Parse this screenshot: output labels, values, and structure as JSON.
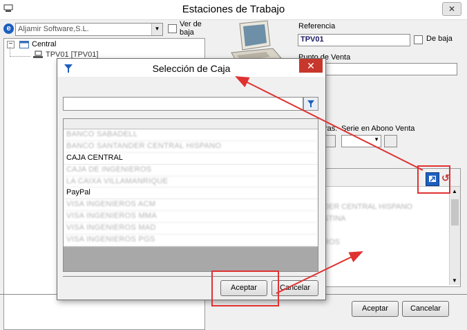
{
  "window": {
    "title": "Estaciones de Trabajo",
    "close_glyph": "✕"
  },
  "company_combo": {
    "value": "Aljamir Software,S.L."
  },
  "ver_de_baja": "Ver de\nbaja",
  "tree": {
    "root": "Central",
    "child": "TPV01 [TPV01]"
  },
  "form": {
    "referencia_label": "Referencia",
    "referencia_value": "TPV01",
    "de_baja_label": "De baja",
    "punto_venta_label": "Punto de Venta",
    "series_label_partial": "ras:",
    "serie_abono_label": "Serie en Abono Venta",
    "right_list_items": [
      "DER CENTRAL HISPANO",
      "STINA",
      "",
      "ROS"
    ]
  },
  "main_buttons": {
    "accept": "Aceptar",
    "cancel": "Cancelar"
  },
  "dialog": {
    "title": "Selección de Caja",
    "close_glyph": "✕",
    "search_value": "",
    "items": [
      {
        "label": "BANCO SABADELL",
        "masked": true
      },
      {
        "label": "BANCO SANTANDER CENTRAL HISPANO",
        "masked": true
      },
      {
        "label": "CAJA CENTRAL",
        "masked": false
      },
      {
        "label": "CAJA DE INGENIEROS",
        "masked": true
      },
      {
        "label": "LA CAIXA VILLAMANRIQUE",
        "masked": true
      },
      {
        "label": "PayPal",
        "masked": false
      },
      {
        "label": "VISA INGENIEROS ACM",
        "masked": true
      },
      {
        "label": "VISA INGENIEROS MMA",
        "masked": true
      },
      {
        "label": "VISA INGENIEROS MAD",
        "masked": true
      },
      {
        "label": "VISA INGENIEROS PGS",
        "masked": true
      }
    ],
    "accept": "Aceptar",
    "cancel": "Cancelar"
  },
  "colors": {
    "accent_red": "#e03131",
    "highlight_blue": "#1d5fbf"
  }
}
